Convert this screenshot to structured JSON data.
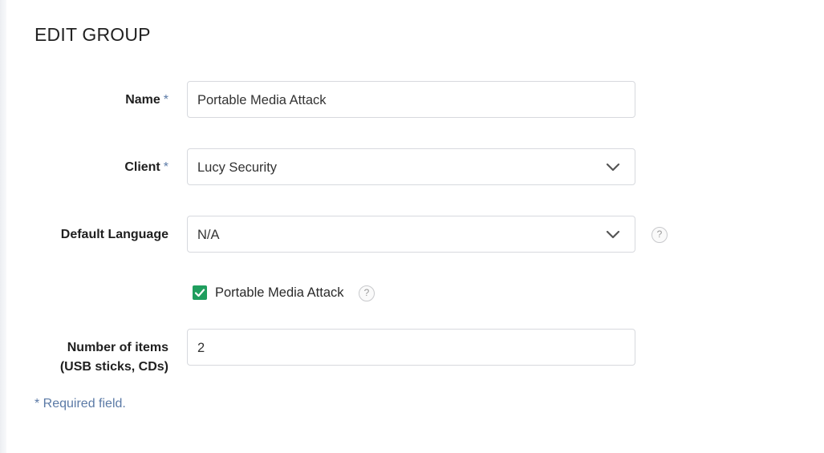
{
  "page": {
    "title": "EDIT GROUP",
    "required_note": "* Required field."
  },
  "form": {
    "name": {
      "label": "Name",
      "required_mark": "*",
      "value": "Portable Media Attack"
    },
    "client": {
      "label": "Client",
      "required_mark": "*",
      "value": "Lucy Security"
    },
    "default_language": {
      "label": "Default Language",
      "value": "N/A",
      "help": "?"
    },
    "portable_media_attack": {
      "label": "Portable Media Attack",
      "checked": true,
      "help": "?"
    },
    "number_of_items": {
      "label_line1": "Number of items",
      "label_line2": "(USB sticks, CDs)",
      "value": "2"
    }
  },
  "colors": {
    "checkbox": "#1f9e5e",
    "required_accent": "#5b7aa6",
    "field_border": "#d7d9de"
  },
  "icons": {
    "dropdown": "chevron-down-icon",
    "help": "help-circle-icon",
    "check": "checkmark-icon"
  }
}
